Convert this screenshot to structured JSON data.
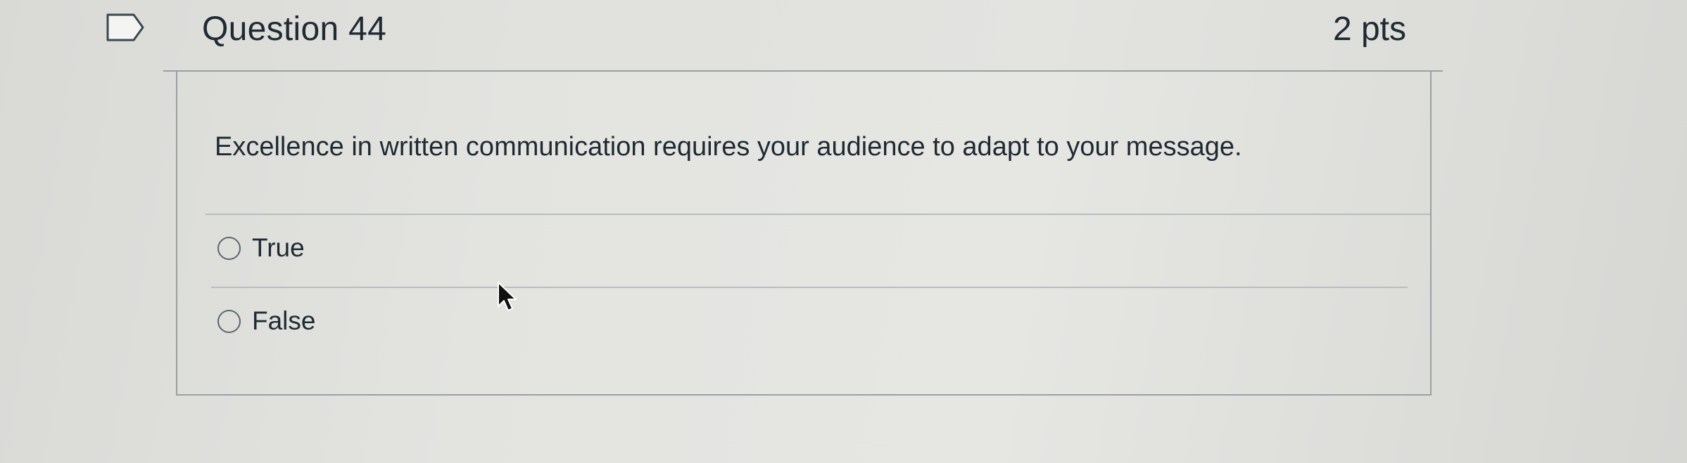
{
  "question": {
    "title": "Question 44",
    "points": "2 pts",
    "text": "Excellence in written communication requires your audience to adapt to your message.",
    "answers": [
      {
        "label": "True",
        "selected": false
      },
      {
        "label": "False",
        "selected": false
      }
    ]
  },
  "icons": {
    "flag": "flag-outline-icon",
    "cursor": "mouse-pointer-icon"
  },
  "colors": {
    "text": "#1f2a33",
    "border": "#9aa0a3",
    "background": "#e3e3e0"
  }
}
